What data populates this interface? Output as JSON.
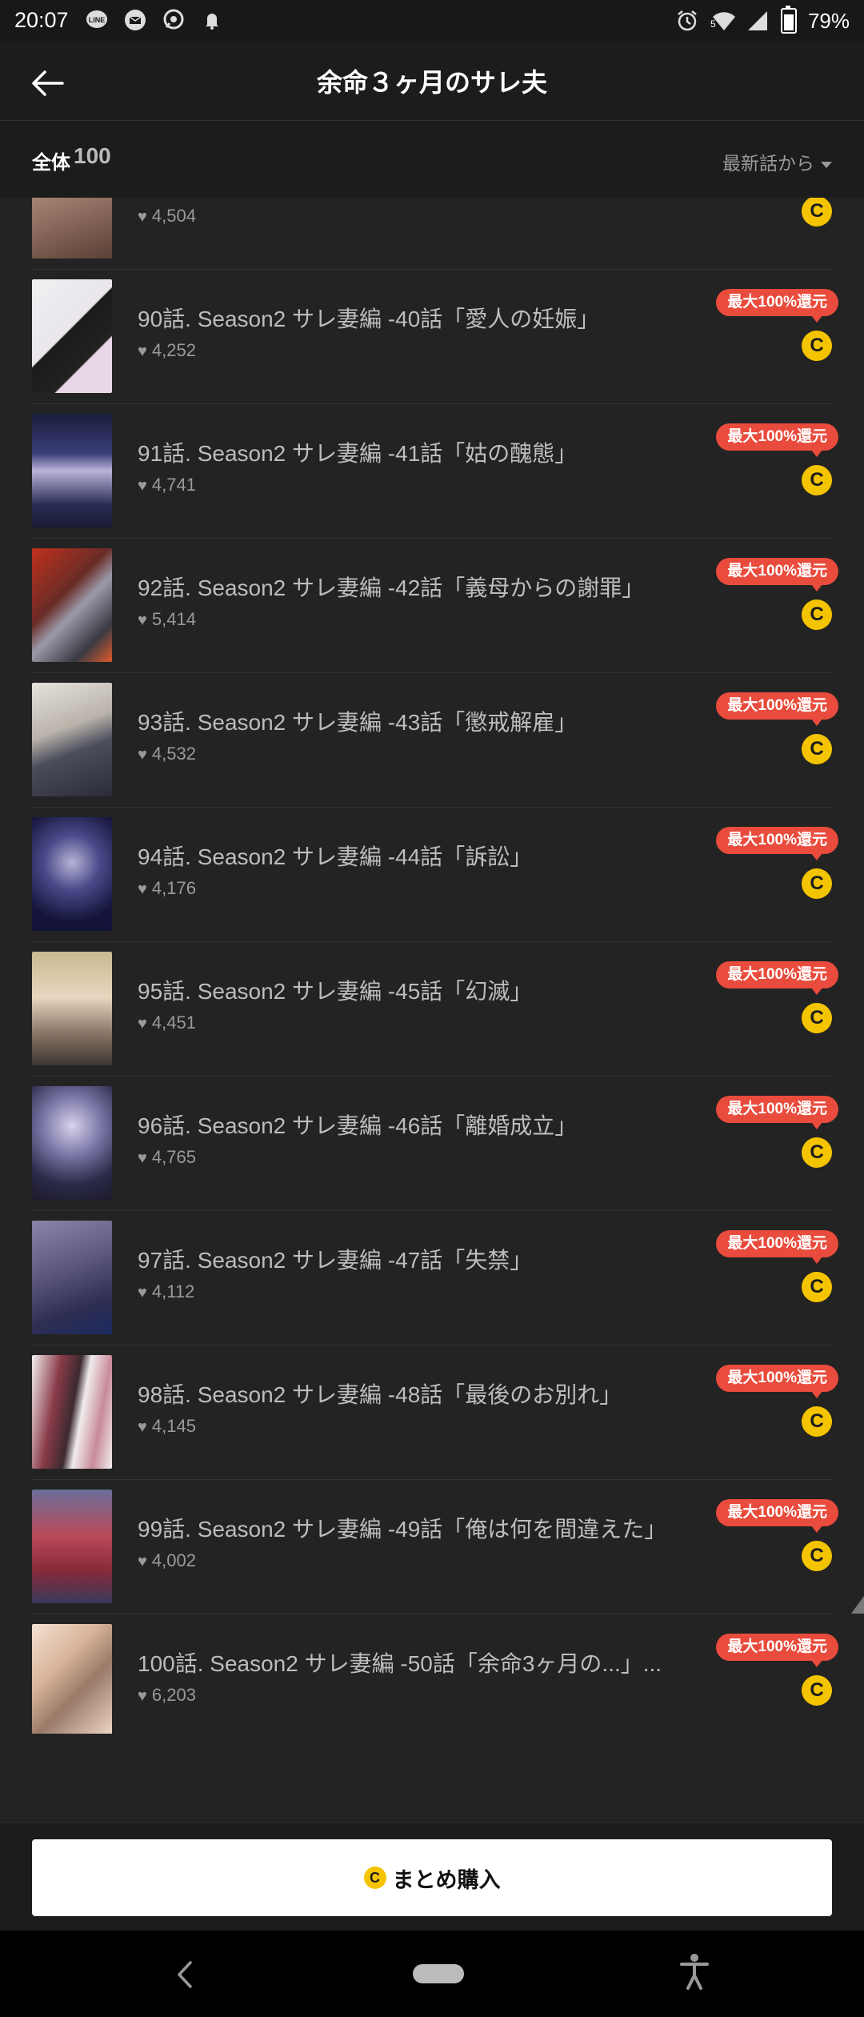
{
  "status_bar": {
    "time": "20:07",
    "notification_icons": [
      "line-icon",
      "mail-icon",
      "chat-icon",
      "bell-icon"
    ],
    "right_icons": [
      "alarm-icon",
      "wifi-icon",
      "signal-icon",
      "battery-icon"
    ],
    "wifi_label": "5",
    "battery": "79%"
  },
  "header": {
    "title": "余命３ヶ月のサレ夫"
  },
  "subheader": {
    "total_label": "全体",
    "total_count": "100",
    "sort_label": "最新話から"
  },
  "episodes": [
    {
      "title": "",
      "likes": "4,504",
      "badge": ""
    },
    {
      "title": "90話. Season2 サレ妻編 -40話「愛人の妊娠」",
      "likes": "4,252",
      "badge": "最大100%還元"
    },
    {
      "title": "91話. Season2 サレ妻編 -41話「姑の醜態」",
      "likes": "4,741",
      "badge": "最大100%還元"
    },
    {
      "title": "92話. Season2 サレ妻編 -42話「義母からの謝罪」",
      "likes": "5,414",
      "badge": "最大100%還元"
    },
    {
      "title": "93話. Season2 サレ妻編 -43話「懲戒解雇」",
      "likes": "4,532",
      "badge": "最大100%還元"
    },
    {
      "title": "94話. Season2 サレ妻編 -44話「訴訟」",
      "likes": "4,176",
      "badge": "最大100%還元"
    },
    {
      "title": "95話. Season2 サレ妻編 -45話「幻滅」",
      "likes": "4,451",
      "badge": "最大100%還元"
    },
    {
      "title": "96話. Season2 サレ妻編 -46話「離婚成立」",
      "likes": "4,765",
      "badge": "最大100%還元"
    },
    {
      "title": "97話. Season2 サレ妻編 -47話「失禁」",
      "likes": "4,112",
      "badge": "最大100%還元"
    },
    {
      "title": "98話. Season2 サレ妻編 -48話「最後のお別れ」",
      "likes": "4,145",
      "badge": "最大100%還元"
    },
    {
      "title": "99話. Season2 サレ妻編 -49話「俺は何を間違えた」",
      "likes": "4,002",
      "badge": "最大100%還元"
    },
    {
      "title": "100話. Season2 サレ妻編 -50話「余命3ヶ月の...」...",
      "likes": "6,203",
      "badge": "最大100%還元"
    }
  ],
  "coin_glyph": "C",
  "buy_button": {
    "label": "まとめ購入"
  },
  "colors": {
    "badge": "#e94b3c",
    "coin": "#f5c400",
    "background": "#232323"
  }
}
